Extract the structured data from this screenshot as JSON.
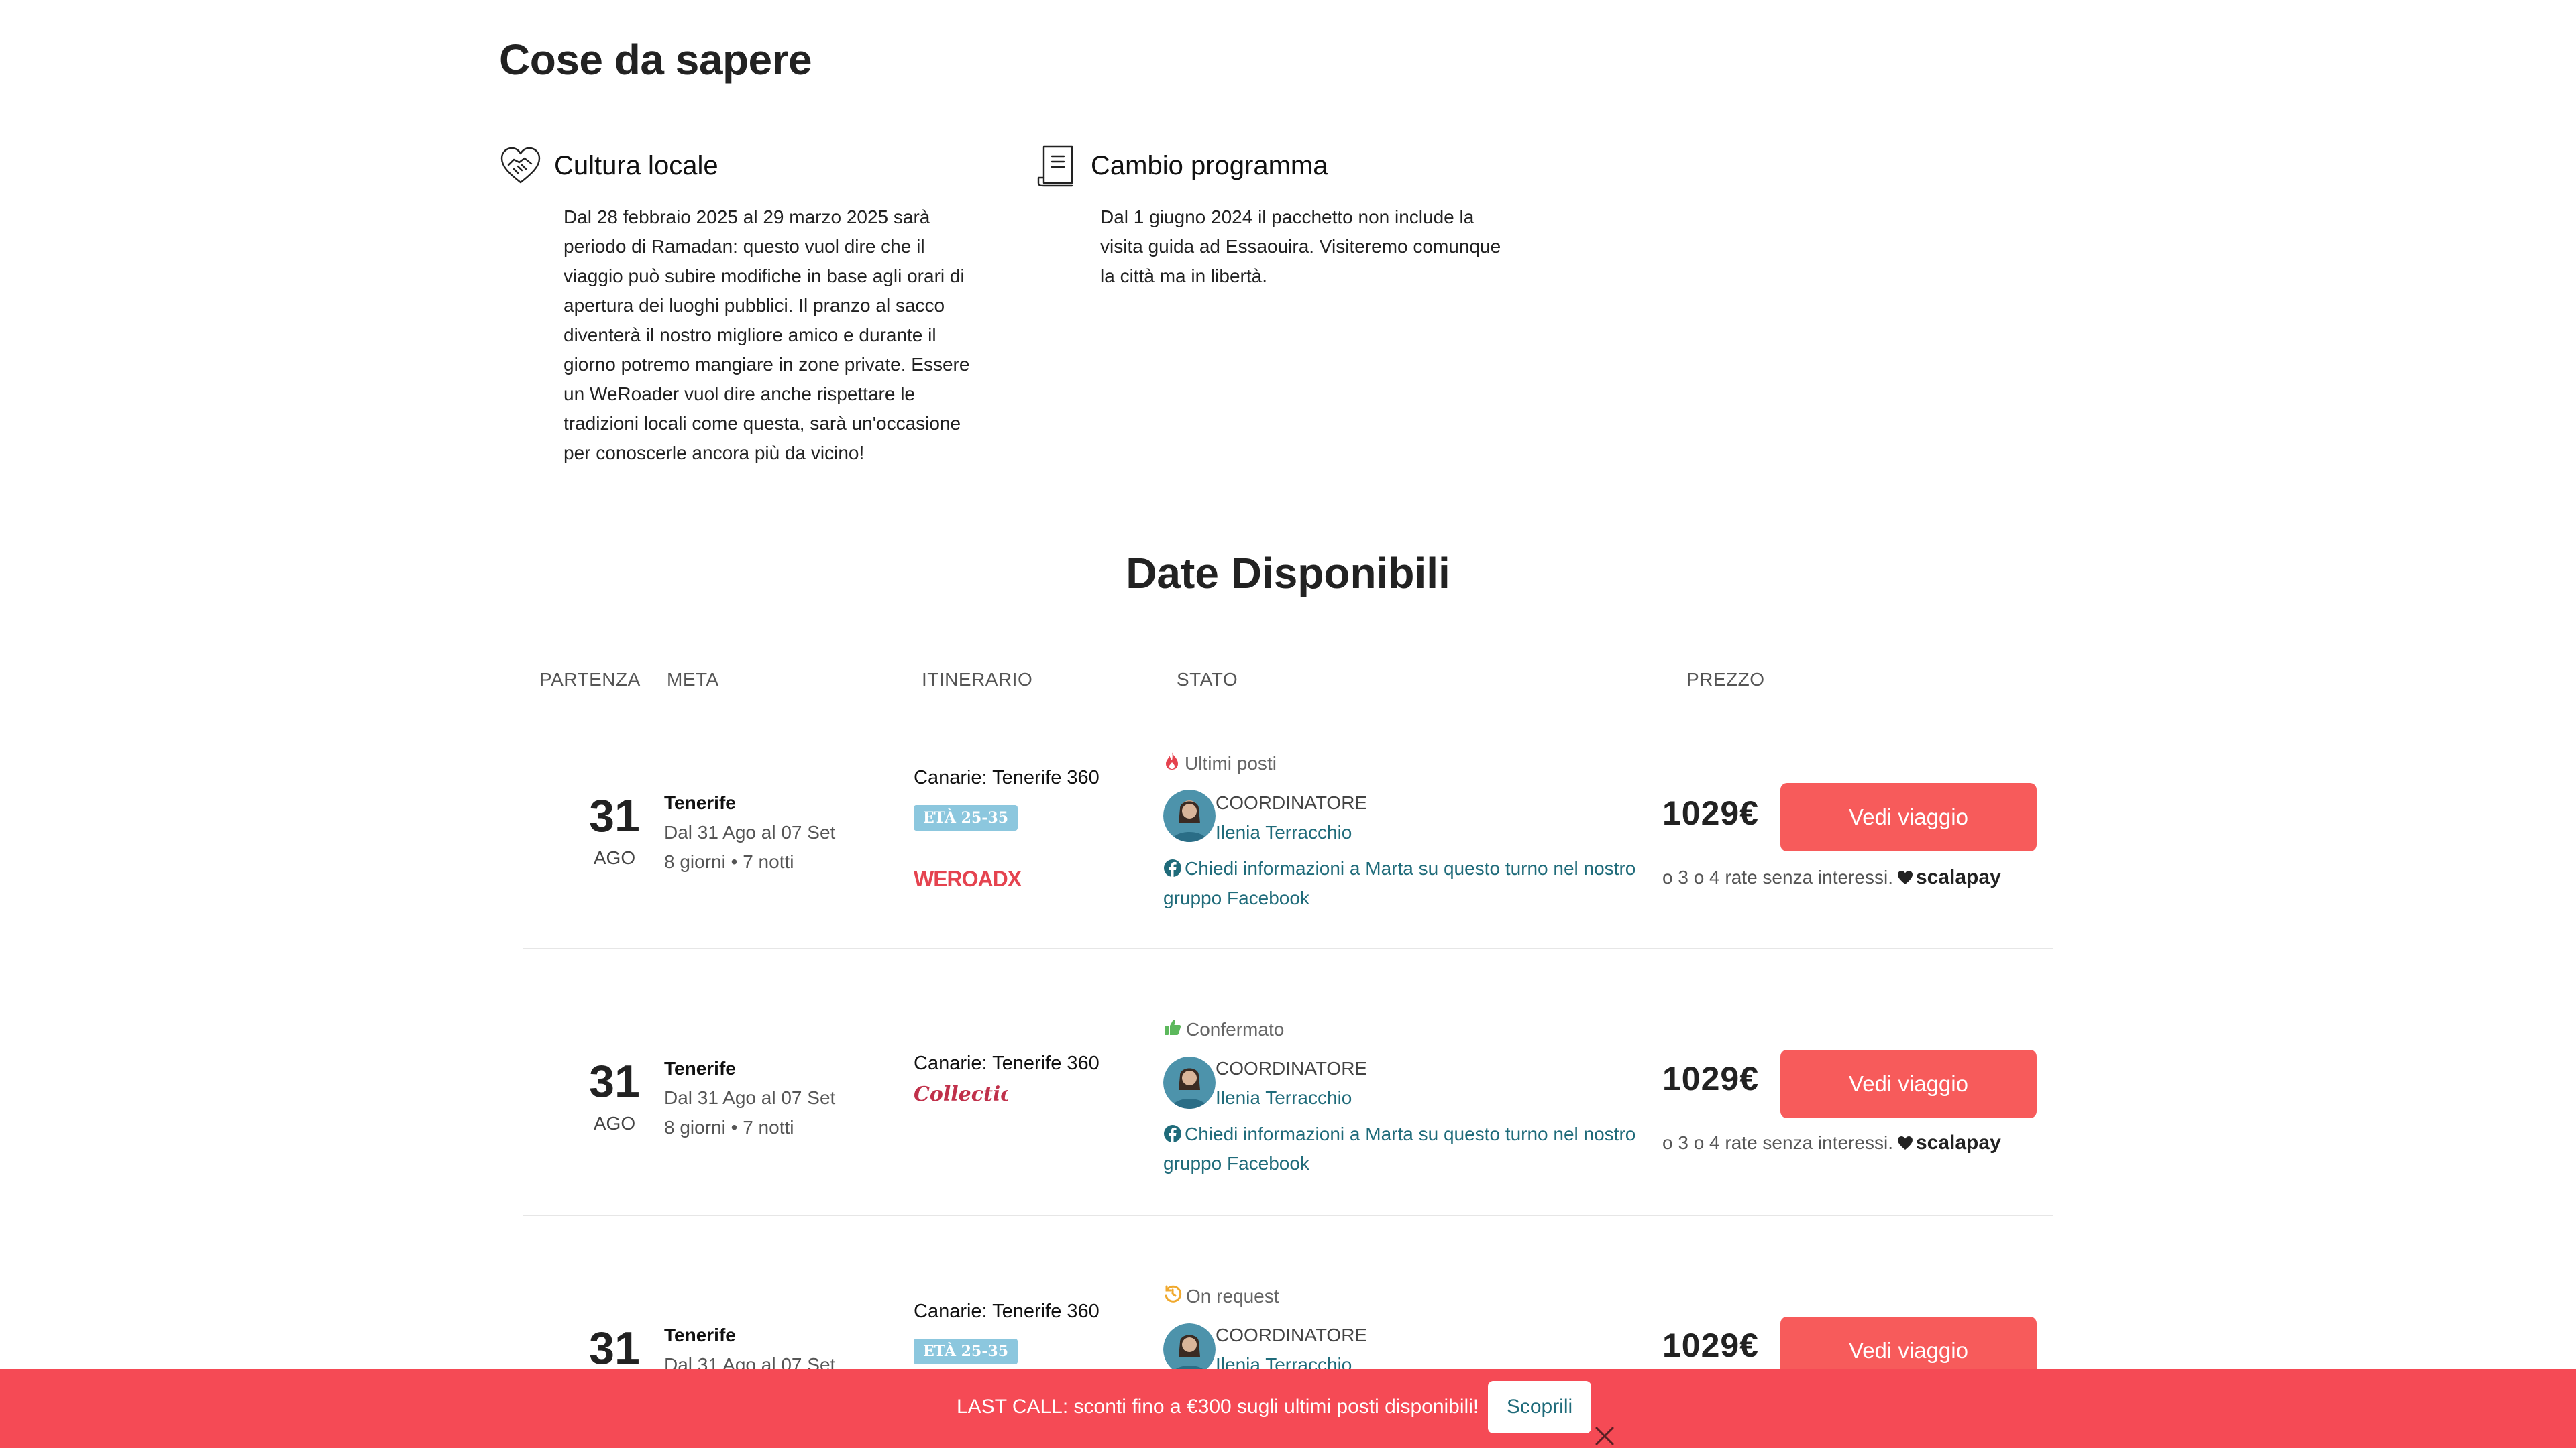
{
  "info": {
    "title": "Cose da sapere",
    "cards": [
      {
        "icon": "handshake-heart-icon",
        "title": "Cultura locale",
        "text": "Dal 28 febbraio 2025 al 29 marzo 2025 sarà periodo di Ramadan: questo vuol dire che il viaggio può subire modifiche in base agli orari di apertura dei luoghi pubblici. Il pranzo al sacco diventerà il nostro migliore amico e durante il giorno potremo mangiare in zone private. Essere un WeRoader vuol dire anche rispettare le tradizioni locali come questa, sarà un'occasione per conoscerle ancora più da vicino!"
      },
      {
        "icon": "scroll-document-icon",
        "title": "Cambio programma",
        "text": "Dal 1 giugno 2024 il pacchetto non include la visita guida ad Essaouira. Visiteremo comunque la città ma in libertà."
      }
    ]
  },
  "dates": {
    "title": "Date Disponibili",
    "columns": [
      "PARTENZA",
      "META",
      "ITINERARIO",
      "STATO",
      "PREZZO"
    ],
    "rows": [
      {
        "day": "31",
        "month": "AGO",
        "destination": "Tenerife",
        "dates": "Dal 31 Ago al 07 Set",
        "nights": "8 giorni • 7 notti",
        "itinerary": "Canarie: Tenerife 360",
        "age_badge": "ETÀ 25-35",
        "brand": "WEROADX",
        "status": "Ultimi posti",
        "status_icon": "fire-icon",
        "status_color": "#e5434f",
        "coord_label": "COORDINATORE",
        "coord_name": "Ilenia Terracchio",
        "fb_text": "Chiedi informazioni a Marta su questo turno nel nostro gruppo Facebook",
        "price": "1029€",
        "cta": "Vedi viaggio",
        "rate_text": "o 3 o 4 rate senza interessi.",
        "rate_brand": "scalapay"
      },
      {
        "day": "31",
        "month": "AGO",
        "destination": "Tenerife",
        "dates": "Dal 31 Ago al 07 Set",
        "nights": "8 giorni • 7 notti",
        "itinerary": "Canarie: Tenerife 360",
        "brand": "Collection",
        "status": "Confermato",
        "status_icon": "thumbs-up-icon",
        "status_color": "#5cb85c",
        "coord_label": "COORDINATORE",
        "coord_name": "Ilenia Terracchio",
        "fb_text": "Chiedi informazioni a Marta su questo turno nel nostro gruppo Facebook",
        "price": "1029€",
        "cta": "Vedi viaggio",
        "rate_text": "o 3 o 4 rate senza interessi.",
        "rate_brand": "scalapay"
      },
      {
        "day": "31",
        "month": "AGO",
        "destination": "Tenerife",
        "dates": "Dal 31 Ago al 07 Set",
        "itinerary": "Canarie: Tenerife 360",
        "age_badge": "ETÀ 25-35",
        "status": "On request",
        "status_icon": "history-icon",
        "status_color": "#f0a92e",
        "coord_label": "COORDINATORE",
        "coord_name": "Ilenia Terracchio",
        "price": "1029€",
        "cta": "Vedi viaggio"
      }
    ]
  },
  "banner": {
    "text": "LAST CALL: sconti fino a €300 sugli ultimi posti disponibili!",
    "button": "Scoprili",
    "color": "#f54a55"
  }
}
